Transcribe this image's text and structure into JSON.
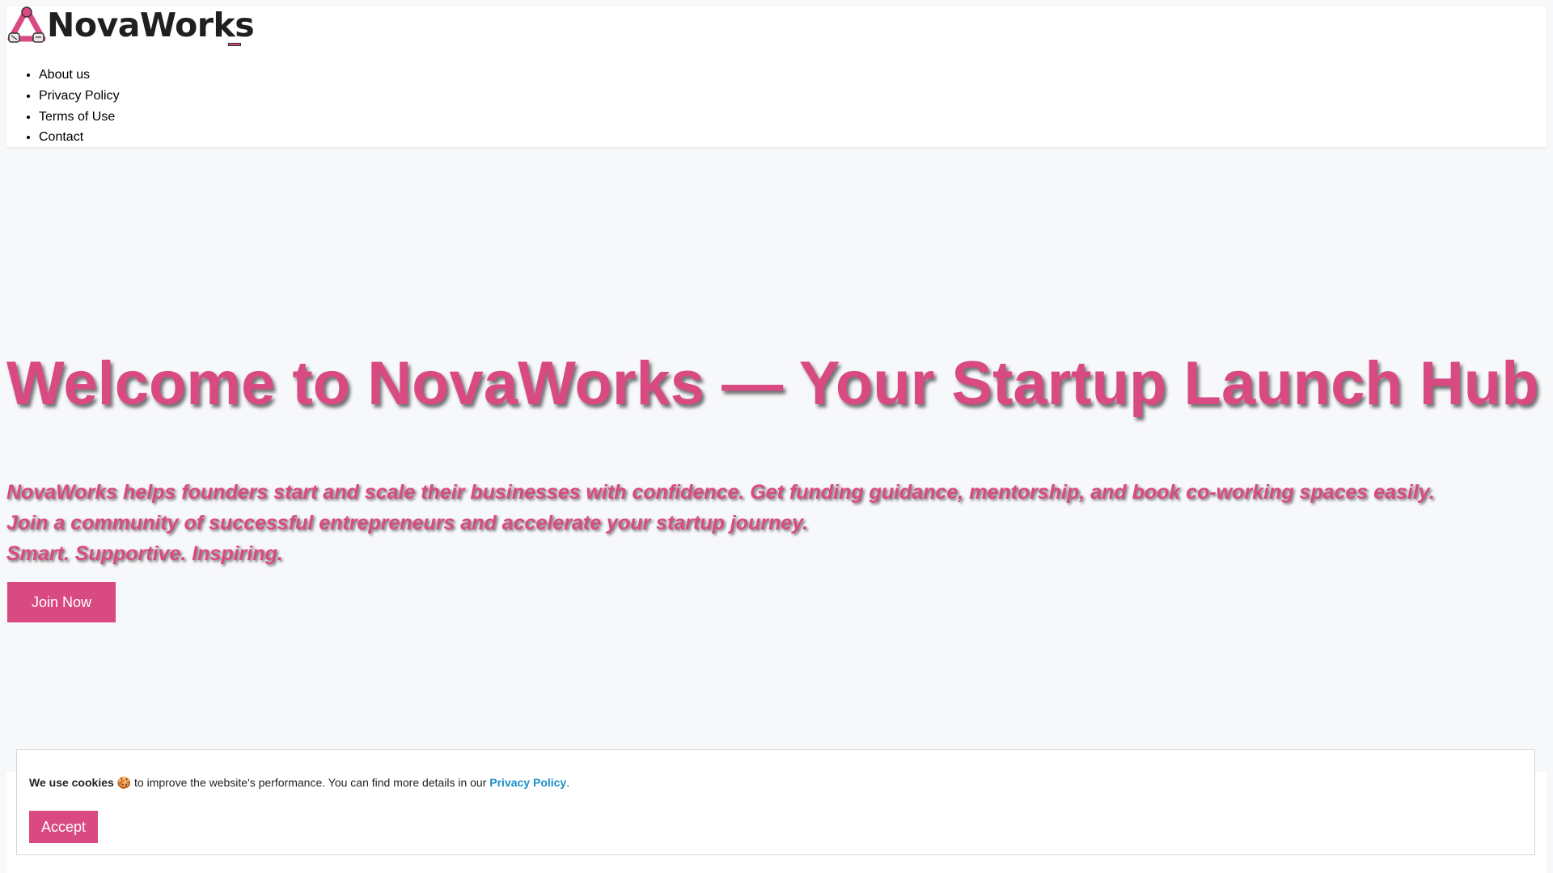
{
  "brand": {
    "name": "NovaWorks",
    "accent_color": "#d94a82",
    "logo_icon": "triangle-gears-logo-icon"
  },
  "header": {
    "menu_toggle_icon": "menu-toggle-icon",
    "nav": [
      {
        "label": "About us"
      },
      {
        "label": "Privacy Policy"
      },
      {
        "label": "Terms of Use"
      },
      {
        "label": "Contact"
      }
    ]
  },
  "hero": {
    "title": "Welcome to NovaWorks — Your Startup Launch Hub",
    "lines": [
      "NovaWorks helps founders start and scale their businesses with confidence. Get funding guidance, mentorship, and book co-working spaces easily.",
      "Join a community of successful entrepreneurs and accelerate your startup journey.",
      "Smart. Supportive. Inspiring."
    ],
    "cta_label": "Join Now"
  },
  "cookie_banner": {
    "bold_lead": "We use cookies",
    "emoji": "🍪",
    "text": " to improve the website's performance. You can find more details in our ",
    "link_label": "Privacy Policy",
    "trailing": ".",
    "accept_label": "Accept",
    "link_color": "#1a8fc9"
  }
}
